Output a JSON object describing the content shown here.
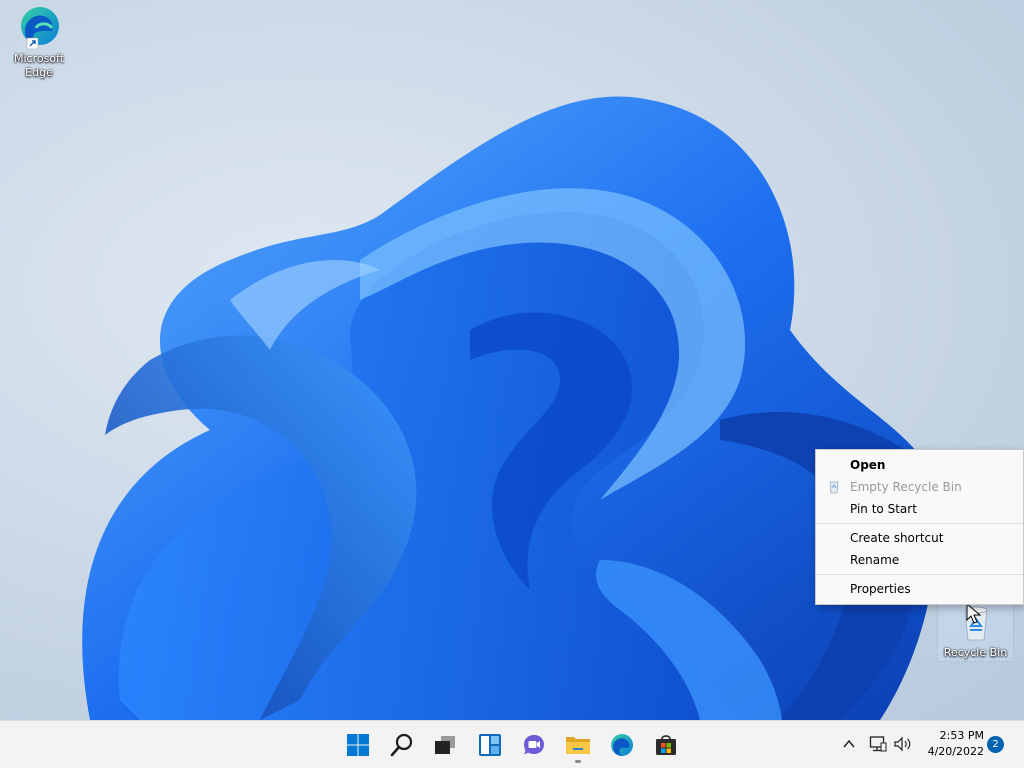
{
  "desktop": {
    "icons": [
      {
        "label_line1": "Microsoft",
        "label_line2": "Edge",
        "icon": "edge-icon"
      },
      {
        "label": "Recycle Bin",
        "icon": "recycle-bin-icon"
      }
    ]
  },
  "context_menu": {
    "items": [
      {
        "label": "Open",
        "bold": true
      },
      {
        "label": "Empty Recycle Bin",
        "disabled": true,
        "icon": "recycle-bin-small-icon"
      },
      {
        "label": "Pin to Start"
      },
      {
        "label": "Create shortcut"
      },
      {
        "label": "Rename"
      },
      {
        "label": "Properties"
      }
    ]
  },
  "taskbar": {
    "buttons": [
      {
        "name": "start",
        "icon": "windows-logo-icon"
      },
      {
        "name": "search",
        "icon": "search-icon"
      },
      {
        "name": "task-view",
        "icon": "task-view-icon"
      },
      {
        "name": "widgets",
        "icon": "widgets-icon"
      },
      {
        "name": "chat",
        "icon": "chat-icon"
      },
      {
        "name": "file-explorer",
        "icon": "folder-icon",
        "running": true
      },
      {
        "name": "edge",
        "icon": "edge-icon"
      },
      {
        "name": "store",
        "icon": "store-icon"
      }
    ],
    "tray": {
      "icons": [
        "chevron-up-icon",
        "network-icon",
        "volume-icon"
      ],
      "time": "2:53 PM",
      "date": "4/20/2022",
      "notification_count": "2"
    }
  },
  "colors": {
    "accent": "#0067c0",
    "wallpaper_blue": "#1e6fe8",
    "taskbar_bg": "#f3f3f3",
    "menu_bg": "#f9f9f9"
  }
}
